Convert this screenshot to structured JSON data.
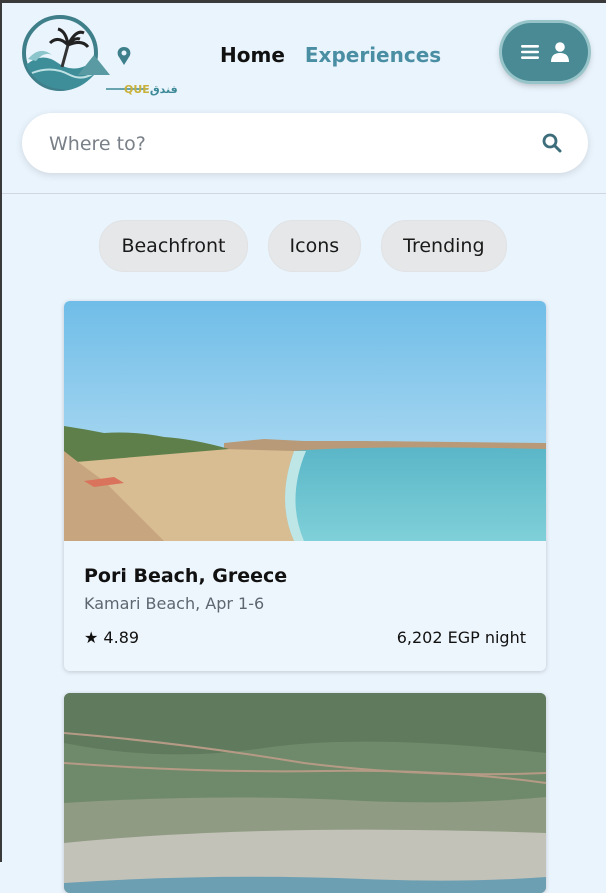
{
  "brand": {
    "logo_text_latin": "QUE",
    "logo_text_arabic": "فندق"
  },
  "nav": {
    "home": "Home",
    "experiences": "Experiences"
  },
  "search": {
    "placeholder": "Where to?"
  },
  "filters": [
    "Beachfront",
    "Icons",
    "Trending"
  ],
  "listings": [
    {
      "title": "Pori Beach, Greece",
      "subtitle": "Kamari Beach, Apr 1-6",
      "rating": "★ 4.89",
      "price": "6,202 EGP night"
    }
  ],
  "colors": {
    "background": "#eaf4fd",
    "accent": "#4a8a95",
    "nav_experiences": "#4a8ea3",
    "chip": "#e6e7e8"
  },
  "icons": [
    "palm-tree-logo-icon",
    "location-pin-icon",
    "menu-icon",
    "user-icon",
    "search-icon",
    "star-icon"
  ]
}
